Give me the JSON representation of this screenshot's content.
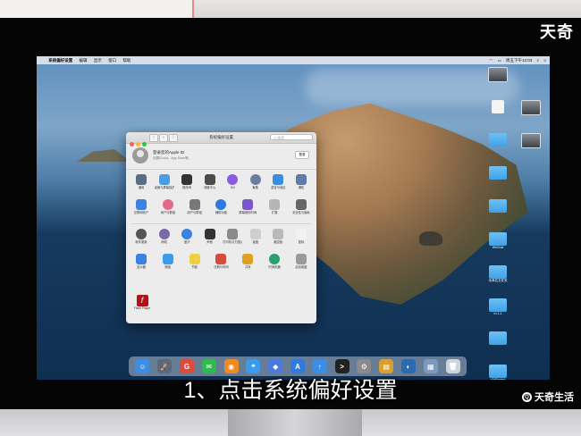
{
  "watermark_top": "天奇",
  "watermark_bottom": "天奇生活",
  "subtitle": "1、点击系统偏好设置",
  "menubar": {
    "items": [
      "系统偏好设置",
      "编辑",
      "显示",
      "窗口",
      "帮助"
    ],
    "clock": "周五下午12:03"
  },
  "window": {
    "title": "系统偏好设置",
    "search_placeholder": "Q 搜索",
    "account": {
      "title": "登录您的Apple ID",
      "subtitle": "设置iCloud、App Store等。",
      "button": "登录"
    },
    "rows": [
      [
        {
          "label": "通用",
          "color": "#5a6d86",
          "icon": "general-icon"
        },
        {
          "label": "桌面与屏幕保护程序",
          "color": "#4a9be0",
          "icon": "desktop-icon"
        },
        {
          "label": "程序坞",
          "color": "#333333",
          "icon": "dock-icon"
        },
        {
          "label": "调度中心",
          "color": "#4b4b4b",
          "icon": "mission-control-icon"
        },
        {
          "label": "Siri",
          "color": "#8a5be0",
          "icon": "siri-icon"
        },
        {
          "label": "聚焦",
          "color": "#6a7fa0",
          "icon": "spotlight-icon"
        },
        {
          "label": "语言与地区",
          "color": "#3b8de0",
          "icon": "language-icon"
        },
        {
          "label": "通知",
          "color": "#5d7aa8",
          "icon": "notifications-icon"
        }
      ],
      [
        {
          "label": "互联网帐户",
          "color": "#3b82e0",
          "icon": "internet-accounts-icon"
        },
        {
          "label": "用户与群组",
          "color": "#e36a88",
          "icon": "users-icon"
        },
        {
          "label": "用户与群组",
          "color": "#777777",
          "icon": "users-groups-icon"
        },
        {
          "label": "辅助功能",
          "color": "#2f7ae0",
          "icon": "accessibility-icon"
        },
        {
          "label": "屏幕使用时间",
          "color": "#7b56c8",
          "icon": "screen-time-icon"
        },
        {
          "label": "扩展",
          "color": "#b5b5b5",
          "icon": "extensions-icon"
        },
        {
          "label": "安全性与隐私",
          "color": "#666666",
          "icon": "security-icon"
        }
      ],
      [
        {
          "label": "软件更新",
          "color": "#555555",
          "icon": "software-update-icon"
        },
        {
          "label": "网络",
          "color": "#7a6aa8",
          "icon": "network-icon"
        },
        {
          "label": "蓝牙",
          "color": "#3b82e0",
          "icon": "bluetooth-icon"
        },
        {
          "label": "声音",
          "color": "#333333",
          "icon": "sound-icon"
        },
        {
          "label": "打印机与扫描仪",
          "color": "#8a8a8a",
          "icon": "printers-icon"
        },
        {
          "label": "键盘",
          "color": "#cfcfcf",
          "icon": "keyboard-icon"
        },
        {
          "label": "触控板",
          "color": "#b9b9b9",
          "icon": "trackpad-icon"
        },
        {
          "label": "鼠标",
          "color": "#f2f2f2",
          "icon": "mouse-icon"
        }
      ],
      [
        {
          "label": "显示器",
          "color": "#3b82e0",
          "icon": "displays-icon"
        },
        {
          "label": "随航",
          "color": "#3a9bea",
          "icon": "sidecar-icon"
        },
        {
          "label": "节能",
          "color": "#f0d040",
          "icon": "energy-icon"
        },
        {
          "label": "日期与时间",
          "color": "#d94a3a",
          "icon": "date-time-icon"
        },
        {
          "label": "共享",
          "color": "#e0a020",
          "icon": "sharing-icon"
        },
        {
          "label": "时间机器",
          "color": "#2aa070",
          "icon": "time-machine-icon"
        },
        {
          "label": "启动磁盘",
          "color": "#9a9a9a",
          "icon": "startup-disk-icon"
        }
      ]
    ],
    "extra": {
      "label": "Flash Player"
    }
  },
  "desktop_icons": [
    {
      "label": "",
      "type": "shot"
    },
    {
      "label": "",
      "type": "doc"
    },
    {
      "label": "",
      "type": "shot"
    },
    {
      "label": "",
      "type": "folder"
    },
    {
      "label": "",
      "type": "shot"
    },
    {
      "label": "",
      "type": "folder"
    },
    {
      "label": "",
      "type": "folder"
    },
    {
      "label": "WeChat",
      "type": "folder"
    },
    {
      "label": "未命名文件夹",
      "type": "folder"
    },
    {
      "label": "v1.1.1",
      "type": "folder"
    },
    {
      "label": "",
      "type": "folder"
    },
    {
      "label": "c2dProject",
      "type": "folder"
    }
  ],
  "dock": [
    {
      "name": "finder-icon",
      "color": "#3a8ee6",
      "glyph": "☺"
    },
    {
      "name": "launchpad-icon",
      "color": "#5a6a7a",
      "glyph": "🚀"
    },
    {
      "name": "app-g-icon",
      "color": "#e04a3a",
      "glyph": "G"
    },
    {
      "name": "wechat-icon",
      "color": "#2dbb4e",
      "glyph": "✉"
    },
    {
      "name": "firefox-icon",
      "color": "#f08a20",
      "glyph": "◉"
    },
    {
      "name": "safari-icon",
      "color": "#3a9bea",
      "glyph": "⌖"
    },
    {
      "name": "app-blue-icon",
      "color": "#4a7ae0",
      "glyph": "◆"
    },
    {
      "name": "app-store-icon",
      "color": "#2f7ae0",
      "glyph": "A"
    },
    {
      "name": "upload-icon",
      "color": "#3a8ee6",
      "glyph": "↑"
    },
    {
      "name": "terminal-icon",
      "color": "#222222",
      "glyph": ">"
    },
    {
      "name": "system-preferences-icon",
      "color": "#8a8a8a",
      "glyph": "⚙"
    },
    {
      "name": "notes-icon",
      "color": "#d9a030",
      "glyph": "▤"
    },
    {
      "name": "app-globe-icon",
      "color": "#2a6ab0",
      "glyph": "◐"
    },
    {
      "name": "preview-icon",
      "color": "#7a9ac0",
      "glyph": "▦"
    },
    {
      "name": "trash-icon",
      "color": "#cfd4da",
      "glyph": "🗑"
    }
  ]
}
